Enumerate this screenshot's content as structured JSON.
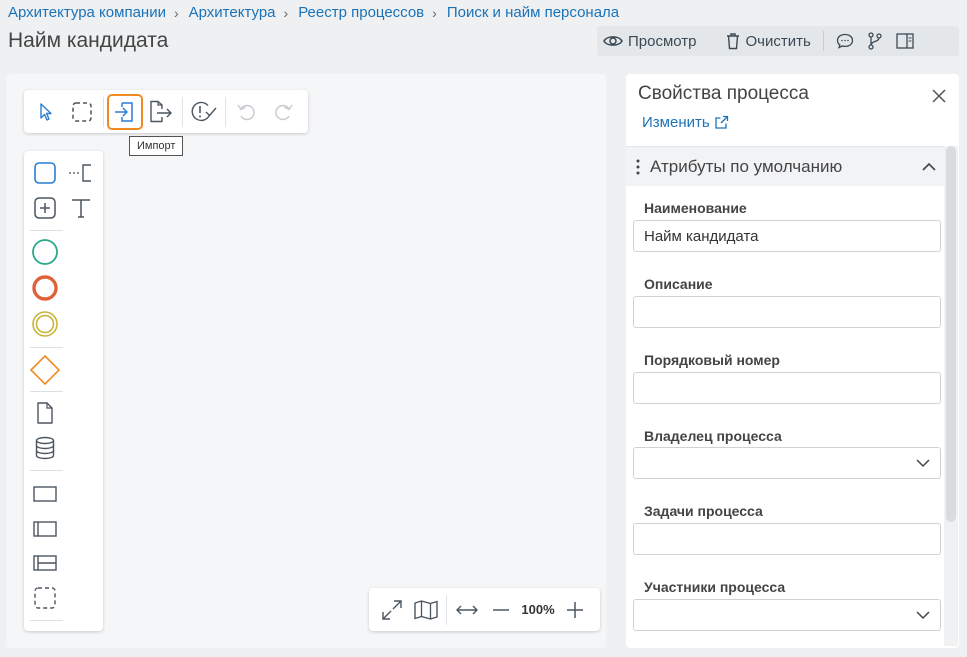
{
  "breadcrumb": [
    "Архитектура компании",
    "Архитектура",
    "Реестр процессов",
    "Поиск и найм персонала"
  ],
  "page_title": "Найм кандидата",
  "toolbar": {
    "preview_label": "Просмотр",
    "clear_label": "Очистить"
  },
  "draw_toolbar": {
    "tooltip": "Импорт"
  },
  "zoom": {
    "level": "100%"
  },
  "properties": {
    "title": "Свойства процесса",
    "edit_link": "Изменить",
    "section_title": "Атрибуты по умолчанию",
    "fields": {
      "name": {
        "label": "Наименование",
        "value": "Найм кандидата"
      },
      "description": {
        "label": "Описание",
        "value": ""
      },
      "order": {
        "label": "Порядковый номер",
        "value": ""
      },
      "owner": {
        "label": "Владелец процесса",
        "value": ""
      },
      "tasks": {
        "label": "Задачи процесса",
        "value": ""
      },
      "participants": {
        "label": "Участники процесса",
        "value": ""
      }
    }
  },
  "colors": {
    "link": "#1a73b8",
    "accent_orange": "#f08a25",
    "start_event": "#2aaa8a",
    "end_event": "#e0603a",
    "intermediate_event": "#c9b43a",
    "gateway": "#f08a25",
    "task": "#2a7fd4"
  }
}
